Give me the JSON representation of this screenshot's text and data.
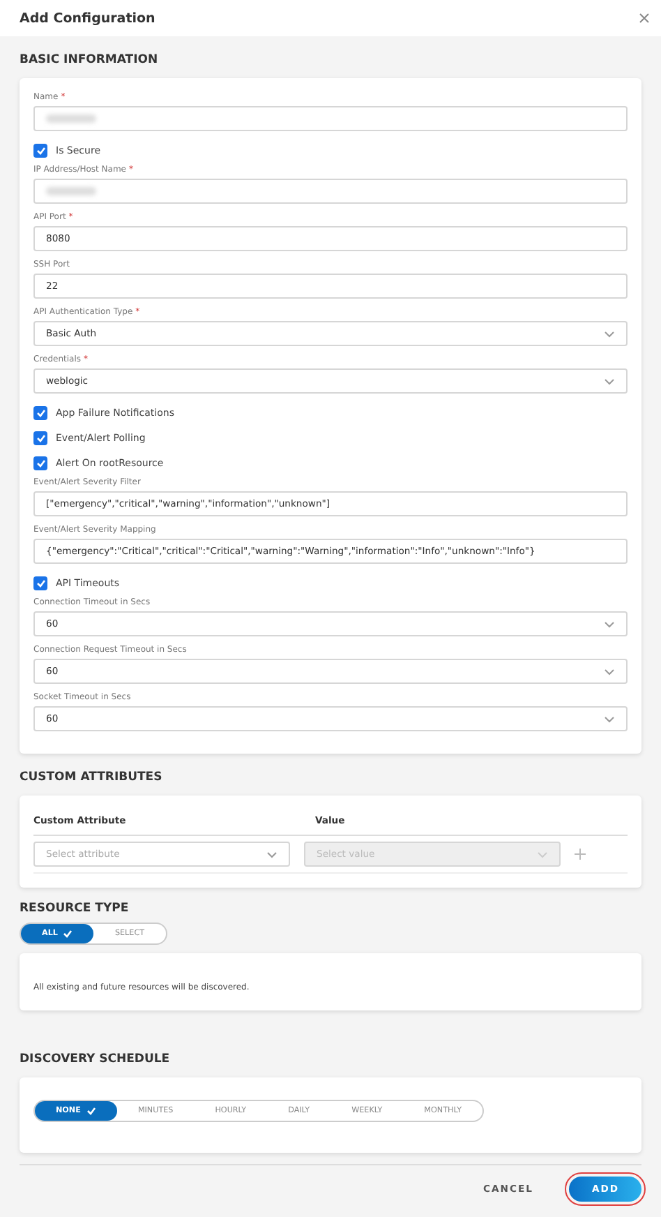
{
  "dialog": {
    "title": "Add Configuration"
  },
  "basic_information": {
    "heading": "BASIC INFORMATION",
    "items": [
      {
        "kind": "text",
        "label": "Name",
        "required_mark": "*",
        "redacted": true
      },
      {
        "kind": "checkbox",
        "label": "Is Secure",
        "checked": true
      },
      {
        "kind": "text",
        "label": "IP Address/Host Name",
        "required_mark": "*",
        "redacted": true
      },
      {
        "kind": "text",
        "label": "API Port",
        "required_mark": "*",
        "value": "8080"
      },
      {
        "kind": "text",
        "label": "SSH Port",
        "value": "22"
      },
      {
        "kind": "select",
        "label": "API Authentication Type",
        "required_mark": "*",
        "value": "Basic Auth"
      },
      {
        "kind": "select",
        "label": "Credentials",
        "required_mark": "*",
        "value": "weblogic"
      },
      {
        "kind": "checkbox",
        "label": "App Failure Notifications",
        "checked": true
      },
      {
        "kind": "checkbox",
        "label": "Event/Alert Polling",
        "checked": true
      },
      {
        "kind": "checkbox",
        "label": "Alert On rootResource",
        "checked": true
      },
      {
        "kind": "text",
        "label": "Event/Alert Severity Filter",
        "value": "[\"emergency\",\"critical\",\"warning\",\"information\",\"unknown\"]"
      },
      {
        "kind": "text",
        "label": "Event/Alert Severity Mapping",
        "value": "{\"emergency\":\"Critical\",\"critical\":\"Critical\",\"warning\":\"Warning\",\"information\":\"Info\",\"unknown\":\"Info\"}"
      },
      {
        "kind": "checkbox",
        "label": "API Timeouts",
        "checked": true
      },
      {
        "kind": "select",
        "label": "Connection Timeout in Secs",
        "value": "60"
      },
      {
        "kind": "select",
        "label": "Connection Request Timeout in Secs",
        "value": "60"
      },
      {
        "kind": "select",
        "label": "Socket Timeout in Secs",
        "value": "60"
      }
    ]
  },
  "custom_attributes": {
    "heading": "CUSTOM ATTRIBUTES",
    "columns": [
      "Custom Attribute",
      "Value"
    ],
    "attribute_select": {
      "placeholder": "Select attribute",
      "disabled": false
    },
    "value_select": {
      "placeholder": "Select value",
      "disabled": true
    }
  },
  "resource_type": {
    "heading": "RESOURCE TYPE",
    "options": [
      {
        "label": "ALL",
        "selected": true
      },
      {
        "label": "SELECT",
        "selected": false
      }
    ],
    "note": "All existing and future resources will be discovered."
  },
  "discovery_schedule": {
    "heading": "DISCOVERY SCHEDULE",
    "options": [
      {
        "label": "NONE",
        "selected": true
      },
      {
        "label": "MINUTES",
        "selected": false
      },
      {
        "label": "HOURLY",
        "selected": false
      },
      {
        "label": "DAILY",
        "selected": false
      },
      {
        "label": "WEEKLY",
        "selected": false
      },
      {
        "label": "MONTHLY",
        "selected": false
      }
    ]
  },
  "buttons": [
    {
      "kind": "text",
      "label": "CANCEL"
    },
    {
      "kind": "primary",
      "label": "ADD"
    }
  ]
}
